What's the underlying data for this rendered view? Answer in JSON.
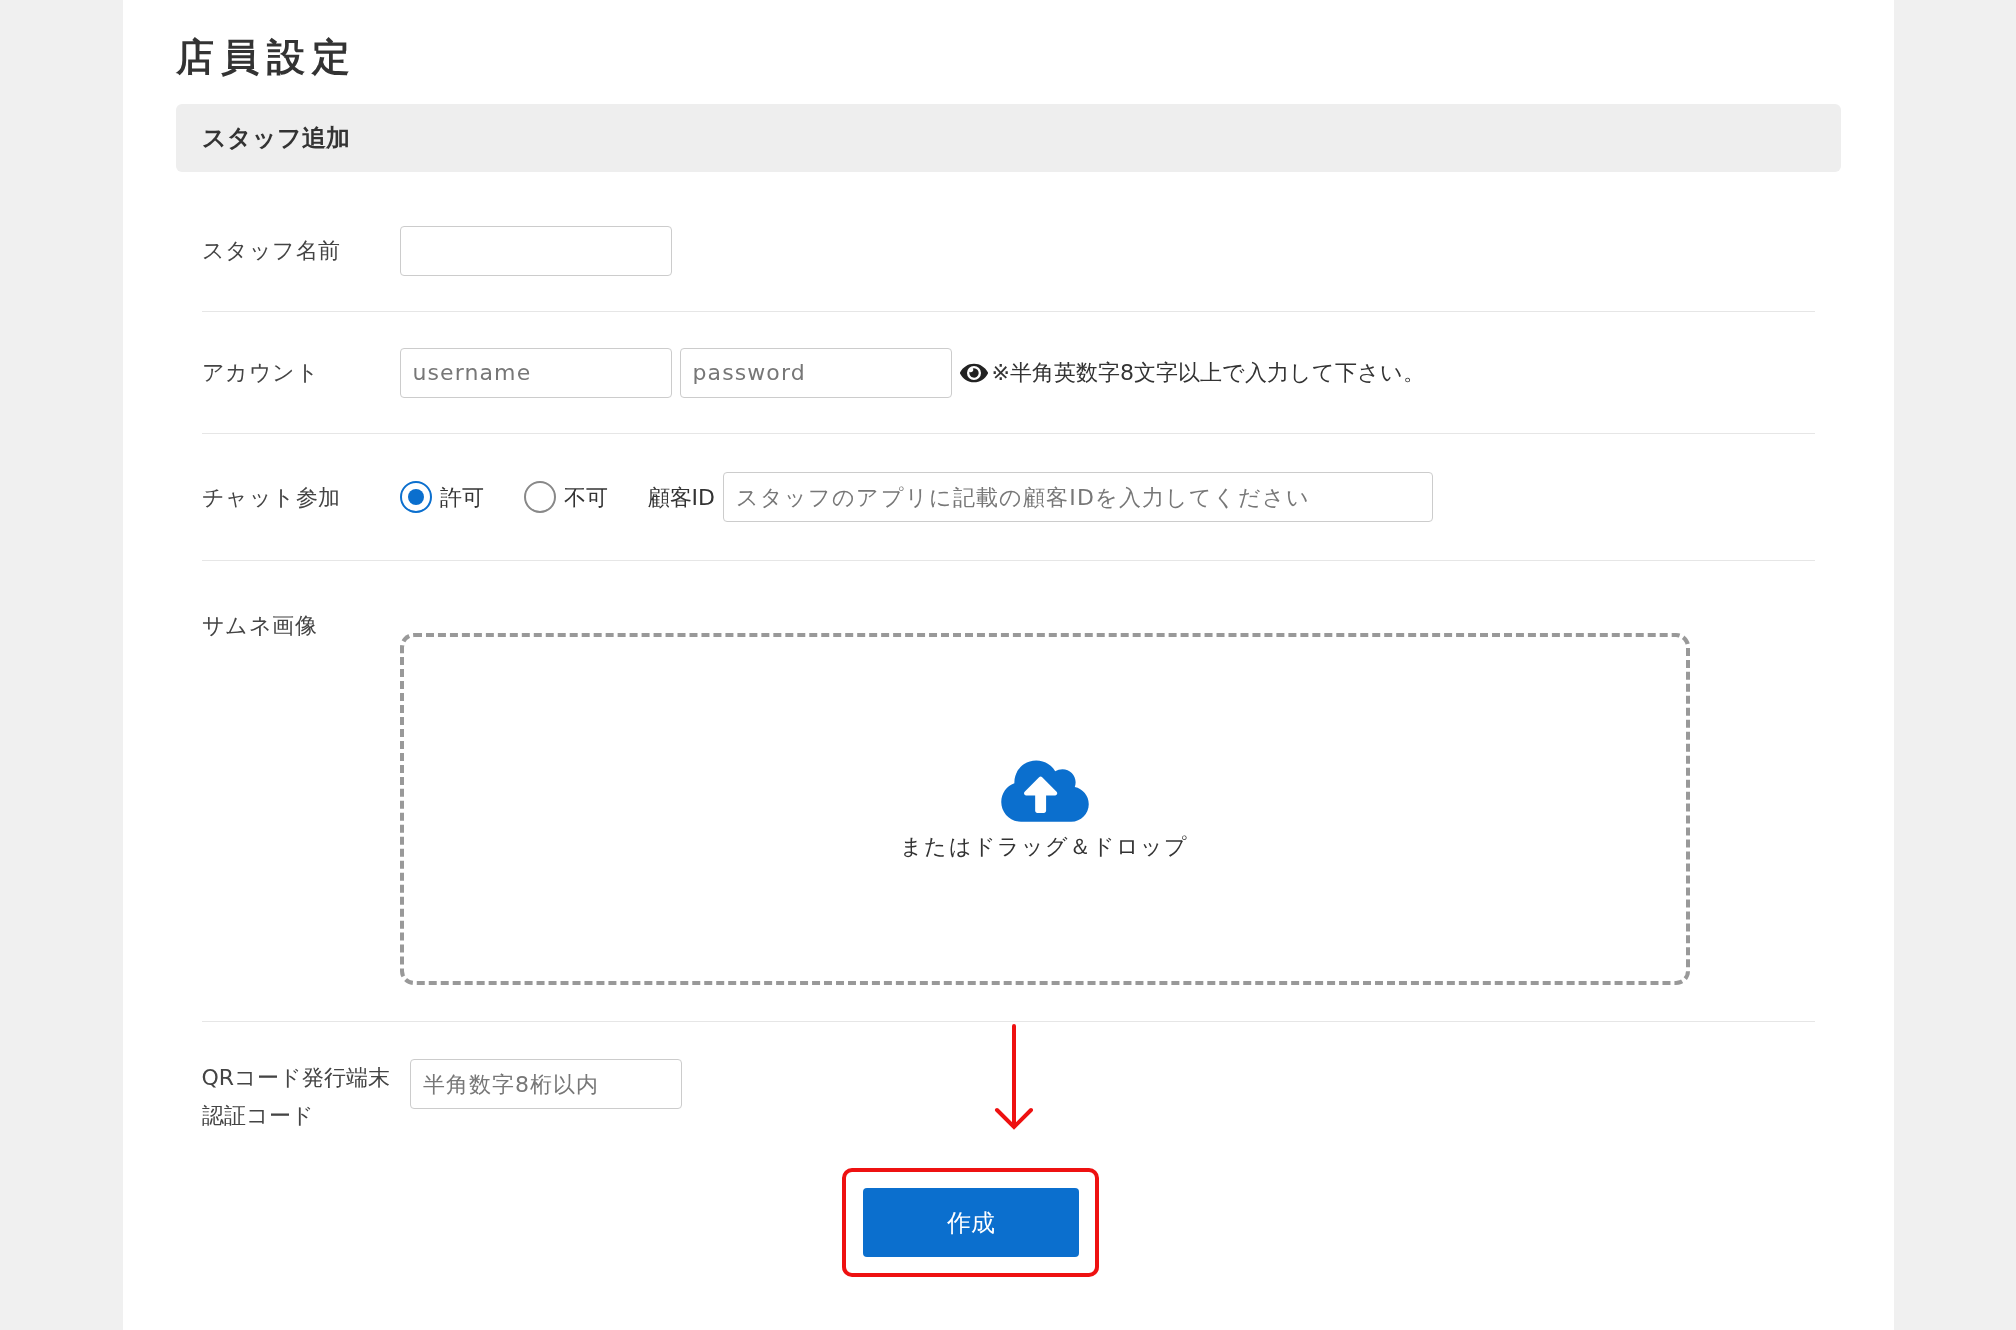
{
  "page": {
    "title": "店員設定"
  },
  "section": {
    "title": "スタッフ追加"
  },
  "form": {
    "staff_name": {
      "label": "スタッフ名前"
    },
    "account": {
      "label": "アカウント",
      "username": {
        "placeholder": "username"
      },
      "password": {
        "placeholder": "password"
      },
      "note": "※半角英数字8文字以上で入力して下さい。"
    },
    "chat": {
      "label": "チャット参加",
      "options": [
        {
          "label": "許可",
          "selected": true
        },
        {
          "label": "不可",
          "selected": false
        }
      ],
      "customer_id": {
        "label": "顧客ID",
        "placeholder": "スタッフのアプリに記載の顧客IDを入力してください"
      }
    },
    "thumbnail": {
      "label": "サムネ画像",
      "dropzone_text": "またはドラッグ＆ドロップ"
    },
    "qr_code": {
      "label": "QRコード発行端末認証コード",
      "placeholder": "半角数字8桁以内"
    }
  },
  "submit": {
    "label": "作成"
  }
}
